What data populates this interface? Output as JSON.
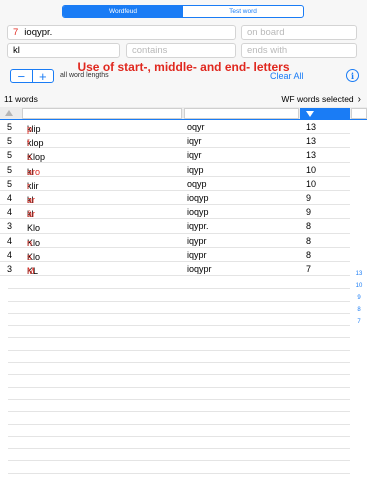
{
  "tabs": [
    {
      "label": "Wordfeud",
      "active": true
    },
    {
      "label": "Test word",
      "active": false
    }
  ],
  "inputs": {
    "letters_count": "7",
    "letters_value": "ioqypr.",
    "on_board_placeholder": "on board",
    "starts_value": "kl",
    "contains_placeholder": "contains",
    "ends_placeholder": "ends with"
  },
  "hint": "Use of start-, middle- and end- letters",
  "stepper": {
    "minus": "−",
    "plus": "+"
  },
  "length_label": "all word lengths",
  "clear_all": "Clear All",
  "info_icon": "i",
  "summary": {
    "count": "11 words",
    "selector": "WF words selected",
    "chevron": "›"
  },
  "results": [
    {
      "len": "5",
      "prefix": "klip",
      "rest": "p",
      "rack": "oqyr",
      "score": "13"
    },
    {
      "len": "5",
      "prefix": "klop",
      "rest": "f",
      "rack": "iqyr",
      "score": "13"
    },
    {
      "len": "5",
      "prefix": "Klop",
      "rest": "s",
      "rack": "iqyr",
      "score": "13"
    },
    {
      "len": "5",
      "prefix": "kl",
      "rest": "aro",
      "rack": "iqyp",
      "score": "10"
    },
    {
      "len": "5",
      "prefix": "klir",
      "rest": "r",
      "rack": "oqyp",
      "score": "10"
    },
    {
      "len": "4",
      "prefix": "kl",
      "rest": "ar",
      "rack": "ioqyp",
      "score": "9"
    },
    {
      "len": "4",
      "prefix": "kl",
      "rest": "âr",
      "rack": "ioqyp",
      "score": "9"
    },
    {
      "len": "3",
      "prefix": "Klo",
      "rest": "",
      "rack": "iqypr.",
      "score": "8"
    },
    {
      "len": "4",
      "prefix": "Klo",
      "rest": "n",
      "rack": "iqypr",
      "score": "8"
    },
    {
      "len": "4",
      "prefix": "Klo",
      "rest": "s",
      "rack": "iqypr",
      "score": "8"
    },
    {
      "len": "3",
      "prefix": "KL",
      "rest": "M",
      "rack": "ioqypr",
      "score": "7"
    }
  ],
  "score_index": [
    "13",
    "10",
    "9",
    "8",
    "7"
  ],
  "colors": {
    "accent": "#1a7cf5",
    "highlight": "#e0281f"
  }
}
